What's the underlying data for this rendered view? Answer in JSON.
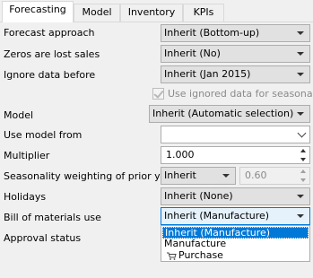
{
  "tabs": [
    "Forecasting",
    "Model",
    "Inventory",
    "KPIs"
  ],
  "rows": {
    "forecast_approach": {
      "label": "Forecast approach",
      "value": "Inherit (Bottom-up)"
    },
    "zeros_lost_sales": {
      "label": "Zeros are lost sales",
      "value": "Inherit (No)"
    },
    "ignore_before": {
      "label": "Ignore data before",
      "value": "Inherit (Jan 2015)"
    },
    "seasonality_checkbox": {
      "label": "Use ignored data for seasonality",
      "checked": true
    },
    "model": {
      "label": "Model",
      "value": "Inherit (Automatic selection)"
    },
    "use_model_from": {
      "label": "Use model from",
      "value": ""
    },
    "multiplier": {
      "label": "Multiplier",
      "value": "1.000"
    },
    "seasonality_weighting": {
      "label": "Seasonality weighting of prior years",
      "select_value": "Inherit",
      "spin_value": "0.60"
    },
    "holidays": {
      "label": "Holidays",
      "value": "Inherit (None)"
    },
    "bom_use": {
      "label": "Bill of materials use",
      "value": "Inherit (Manufacture)"
    },
    "approval_status": {
      "label": "Approval status"
    }
  },
  "bom_options": [
    "Inherit (Manufacture)",
    "Manufacture",
    "Purchase"
  ],
  "colors": {
    "selection": "#0078d7",
    "focus_border": "#0078d7"
  }
}
